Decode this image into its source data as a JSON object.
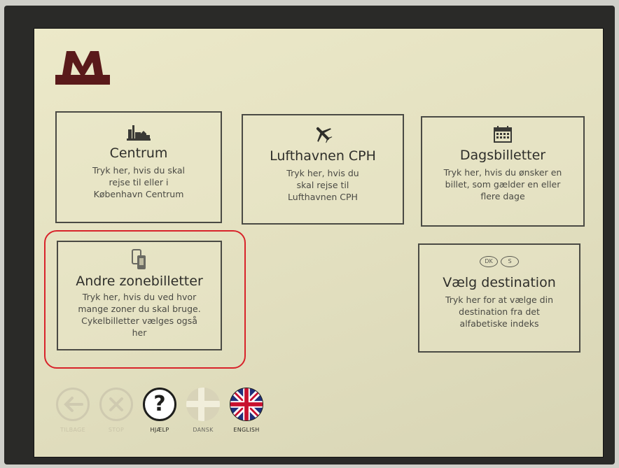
{
  "tiles": {
    "centrum": {
      "title": "Centrum",
      "desc": [
        "Tryk her, hvis du skal",
        "rejse til eller i",
        "København Centrum"
      ]
    },
    "airport": {
      "title": "Lufthavnen CPH",
      "desc": [
        "Tryk her, hvis du",
        "skal rejse til",
        "Lufthavnen CPH"
      ]
    },
    "day": {
      "title": "Dagsbilletter",
      "desc": [
        "Tryk her, hvis du ønsker en",
        "billet, som gælder en eller",
        "flere dage"
      ]
    },
    "zones": {
      "title": "Andre zonebilletter",
      "desc": [
        "Tryk her, hvis du ved hvor",
        "mange zoner du skal bruge.",
        "Cykelbilletter vælges også",
        "her"
      ]
    },
    "destination": {
      "title": "Vælg destination",
      "desc": [
        "Tryk her for at vælge din",
        "destination fra det",
        "alfabetiske indeks"
      ],
      "badges": [
        "DK",
        "S"
      ]
    }
  },
  "nav": {
    "back": "TILBAGE",
    "stop": "STOP",
    "help": "HJÆLP",
    "danish": "DANSK",
    "english": "ENGLISH"
  },
  "colors": {
    "logo": "#5a1a1a",
    "highlight": "#d8232a",
    "screen": "#e6e3c3",
    "disabled": "#cfcab0"
  },
  "icons": [
    "metro-logo",
    "city-skyline-icon",
    "airplane-icon",
    "calendar-icon",
    "phone-card-icon",
    "back-arrow-icon",
    "stop-x-icon",
    "question-mark-icon",
    "danish-flag-icon",
    "union-jack-flag-icon"
  ]
}
